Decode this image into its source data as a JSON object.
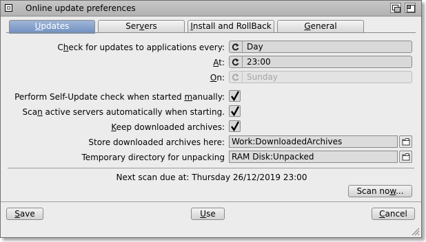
{
  "window": {
    "title": "Online update preferences"
  },
  "tabs": [
    {
      "pre": "",
      "key": "U",
      "post": "pdates",
      "active": true
    },
    {
      "pre": "Ser",
      "key": "v",
      "post": "ers",
      "active": false
    },
    {
      "pre": "",
      "key": "I",
      "post": "nstall and RollBack",
      "active": false
    },
    {
      "pre": "",
      "key": "G",
      "post": "eneral",
      "active": false
    }
  ],
  "schedule": {
    "every": {
      "pre": "C",
      "key": "h",
      "post": "eck for updates to applications every:",
      "value": "Day"
    },
    "at": {
      "pre": "",
      "key": "A",
      "post": "t:",
      "value": "23:00"
    },
    "on": {
      "pre": "",
      "key": "O",
      "post": "n:",
      "value": "Sunday",
      "disabled": true
    }
  },
  "options": {
    "self_update": {
      "pre": "Perform Self-Update check when started ",
      "key": "m",
      "post": "anually:",
      "checked": true
    },
    "scan_active": {
      "pre": "Sca",
      "key": "n",
      "post": " active servers automatically when starting.",
      "checked": true
    },
    "keep_archives": {
      "pre": "",
      "key": "K",
      "post": "eep downloaded archives:",
      "checked": true
    }
  },
  "paths": {
    "store": {
      "label": "Store downloaded archives here:",
      "value": "Work:DownloadedArchives"
    },
    "temp": {
      "label": "Temporary directory for unpacking",
      "value": "RAM Disk:Unpacked"
    }
  },
  "next_scan": "Next scan due at: Thursday 26/12/2019 23:00",
  "buttons": {
    "scan_now": {
      "pre": "Scan no",
      "key": "w",
      "post": "..."
    },
    "save": {
      "pre": "",
      "key": "S",
      "post": "ave"
    },
    "use": {
      "pre": "",
      "key": "U",
      "post": "se"
    },
    "cancel": {
      "pre": "",
      "key": "C",
      "post": "ancel"
    }
  }
}
